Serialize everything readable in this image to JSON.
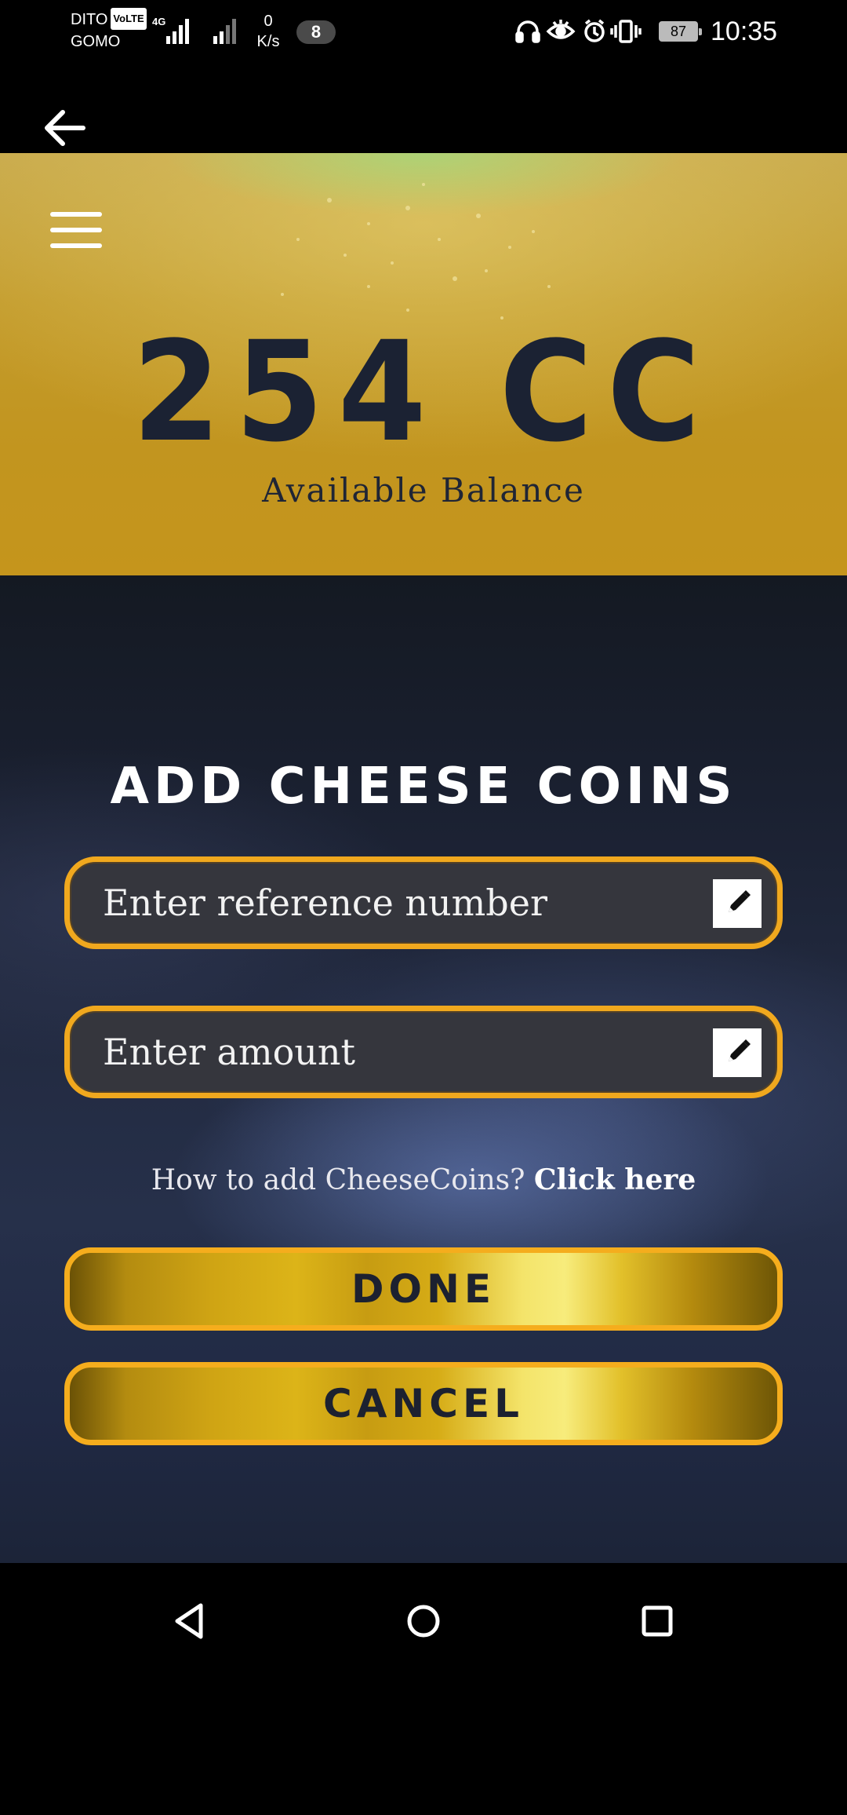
{
  "status_bar": {
    "carrier_top": "DITO",
    "volte_badge": "VoLTE",
    "carrier_bottom": "GOMO",
    "network_type": "4G",
    "speed_value": "0",
    "speed_unit": "K/s",
    "notification_count": "8",
    "battery_level": "87",
    "time": "10:35"
  },
  "header": {
    "balance_amount": "254 CC",
    "balance_label": "Available Balance"
  },
  "form": {
    "title": "ADD CHEESE COINS",
    "reference_placeholder": "Enter reference number",
    "amount_placeholder": "Enter amount",
    "help_text": "How to add CheeseCoins?",
    "help_link": "Click here",
    "done_label": "DONE",
    "cancel_label": "CANCEL"
  },
  "colors": {
    "accent_gold": "#f0a81e",
    "header_gold": "#c39b2c",
    "text_navy": "#1b2233",
    "field_bg": "#35363d"
  },
  "icons": [
    "back-arrow-icon",
    "hamburger-menu-icon",
    "pencil-icon",
    "nav-back-icon",
    "nav-home-icon",
    "nav-recents-icon",
    "headphones-icon",
    "eye-icon",
    "alarm-icon",
    "vibrate-icon"
  ]
}
